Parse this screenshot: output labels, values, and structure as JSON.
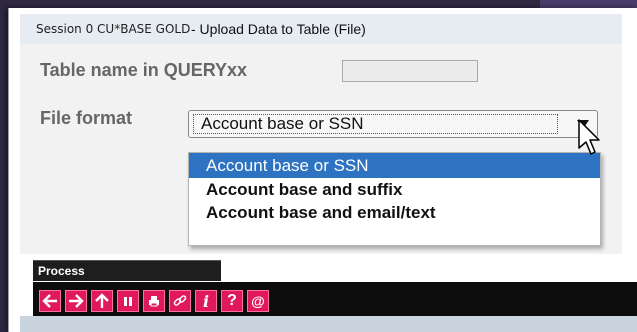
{
  "window": {
    "session": "Session 0 CU*BASE GOLD",
    "title": "- Upload Data to Table (File)"
  },
  "form": {
    "table_name_label": "Table name in QUERYxx",
    "table_name_value": "",
    "file_format_label": "File format",
    "file_format_selected": "Account base or SSN",
    "file_format_options": [
      "Account base or SSN",
      "Account base and suffix",
      "Account base and email/text"
    ]
  },
  "process": {
    "label": "Process"
  },
  "toolbar": {
    "buttons": [
      "back-icon",
      "forward-icon",
      "up-icon",
      "pause-icon",
      "print-icon",
      "link-icon",
      "info-icon",
      "help-icon",
      "email-icon"
    ],
    "info_glyph": "i",
    "help_glyph": "?",
    "email_glyph": "@"
  },
  "colors": {
    "accent": "#e0185c",
    "selection": "#2d73c2",
    "toolbar_bg": "#0c0c0c"
  }
}
